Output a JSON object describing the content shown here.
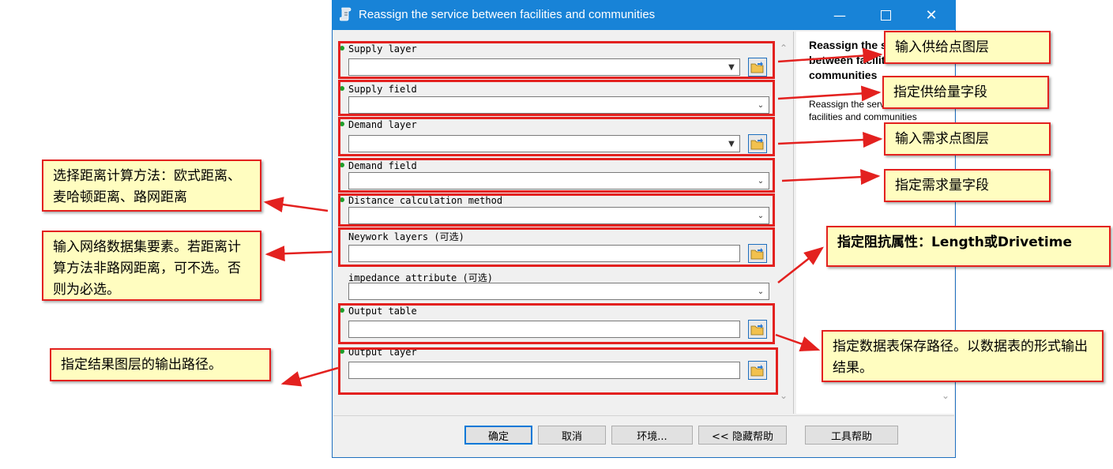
{
  "window": {
    "title": "Reassign the service between facilities and communities",
    "controls": [
      "minimize-icon",
      "maximize-icon",
      "close-icon"
    ]
  },
  "params": [
    {
      "label": "Supply layer",
      "required": true,
      "control": "combo-browse"
    },
    {
      "label": "Supply field",
      "required": true,
      "control": "dropdown"
    },
    {
      "label": "Demand layer",
      "required": true,
      "control": "combo-browse"
    },
    {
      "label": "Demand field",
      "required": true,
      "control": "dropdown"
    },
    {
      "label": "Distance calculation method",
      "required": true,
      "control": "dropdown"
    },
    {
      "label": "Neywork layers (可选)",
      "required": false,
      "control": "text-browse"
    },
    {
      "label": "impedance_attribute (可选)",
      "required": false,
      "control": "dropdown"
    },
    {
      "label": "Output table",
      "required": true,
      "control": "text-browse"
    },
    {
      "label": "Output layer",
      "required": true,
      "control": "text-browse"
    }
  ],
  "help": {
    "title": "Reassign the service between facilities and communities",
    "body": "Reassign the service between facilities and communities"
  },
  "footer": {
    "ok": "确定",
    "cancel": "取消",
    "env": "环境...",
    "hide_help": "<< 隐藏帮助",
    "tool_help": "工具帮助"
  },
  "annotations": {
    "supply_layer": "输入供给点图层",
    "supply_field": "指定供给量字段",
    "demand_layer": "输入需求点图层",
    "demand_field": "指定需求量字段",
    "distance_method": "选择距离计算方法：欧式距离、麦哈顿距离、路网距离",
    "network_layers": "输入网络数据集要素。若距离计算方法非路网距离，可不选。否则为必选。",
    "impedance": "指定阻抗属性：Length或Drivetime",
    "output_table": "指定数据表保存路径。以数据表的形式输出结果。",
    "output_layer": "指定结果图层的输出路径。"
  },
  "colors": {
    "titlebar": "#1883d7",
    "annotation_border": "#e3211f",
    "annotation_fill": "#fffdc0",
    "required_dot": "#1e9e2a"
  }
}
